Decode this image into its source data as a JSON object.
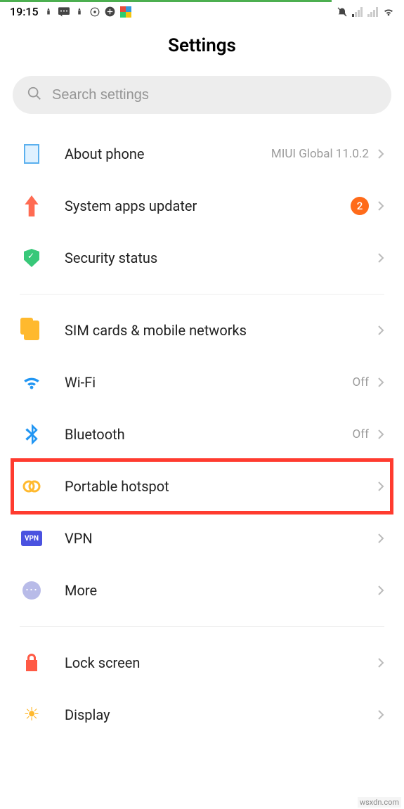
{
  "status_bar": {
    "time": "19:15"
  },
  "header": {
    "title": "Settings"
  },
  "search": {
    "placeholder": "Search settings"
  },
  "group1": [
    {
      "key": "about",
      "label": "About phone",
      "value": "MIUI Global 11.0.2",
      "icon": "about-phone-icon"
    },
    {
      "key": "updater",
      "label": "System apps updater",
      "badge": "2",
      "icon": "arrow-up-icon"
    },
    {
      "key": "security",
      "label": "Security status",
      "icon": "shield-icon"
    }
  ],
  "group2": [
    {
      "key": "sim",
      "label": "SIM cards & mobile networks",
      "icon": "sim-icon"
    },
    {
      "key": "wifi",
      "label": "Wi-Fi",
      "value": "Off",
      "icon": "wifi-icon"
    },
    {
      "key": "bluetooth",
      "label": "Bluetooth",
      "value": "Off",
      "icon": "bluetooth-icon"
    },
    {
      "key": "hotspot",
      "label": "Portable hotspot",
      "icon": "hotspot-icon",
      "highlighted": true
    },
    {
      "key": "vpn",
      "label": "VPN",
      "vpn_text": "VPN",
      "icon": "vpn-icon"
    },
    {
      "key": "more",
      "label": "More",
      "icon": "more-icon"
    }
  ],
  "group3": [
    {
      "key": "lock",
      "label": "Lock screen",
      "icon": "lock-icon"
    },
    {
      "key": "display",
      "label": "Display",
      "icon": "sun-icon"
    }
  ],
  "watermark": "wsxdn.com"
}
